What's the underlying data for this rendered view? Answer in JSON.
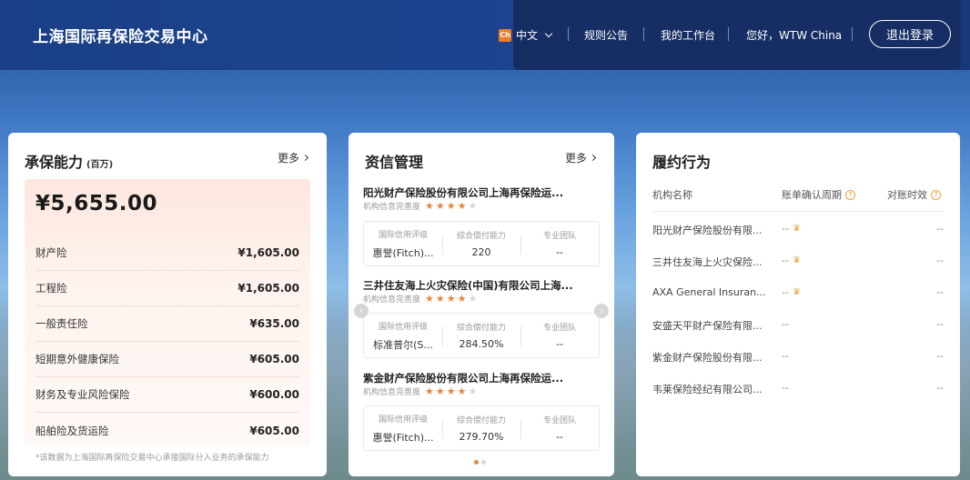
{
  "header": {
    "site_title": "上海国际再保险交易中心",
    "lang_badge": "Ch",
    "lang_label": "中文",
    "nav": [
      "规则公告",
      "我的工作台",
      "您好，WTW China"
    ],
    "logout": "退出登录"
  },
  "capacity": {
    "title": "承保能力",
    "unit": "(百万)",
    "more": "更多",
    "total": "¥5,655.00",
    "rows": [
      {
        "label": "财产险",
        "value": "¥1,605.00"
      },
      {
        "label": "工程险",
        "value": "¥1,605.00"
      },
      {
        "label": "一般责任险",
        "value": "¥635.00"
      },
      {
        "label": "短期意外健康保险",
        "value": "¥605.00"
      },
      {
        "label": "财务及专业风险保险",
        "value": "¥600.00"
      },
      {
        "label": "船舶险及货运险",
        "value": "¥605.00"
      }
    ],
    "note": "*该数据为上海国际再保险交易中心承接国际分入业务的承保能力"
  },
  "credit": {
    "title": "资信管理",
    "more": "更多",
    "info_label": "机构信息完善度",
    "metric_labels": [
      "国际信用评级",
      "综合偿付能力",
      "专业团队"
    ],
    "companies": [
      {
        "name": "阳光财产保险股份有限公司上海再保险运...",
        "stars": 4,
        "rating": "惠誉(Fitch)...",
        "solvency": "220",
        "team": "--"
      },
      {
        "name": "三井住友海上火灾保险(中国)有限公司上海...",
        "stars": 4,
        "rating": "标准普尔(S...",
        "solvency": "284.50%",
        "team": "--"
      },
      {
        "name": "紫金财产保险股份有限公司上海再保险运...",
        "stars": 4,
        "rating": "惠誉(Fitch)...",
        "solvency": "279.70%",
        "team": "--"
      }
    ],
    "page_total": 2,
    "page_active": 1
  },
  "performance": {
    "title": "履约行为",
    "columns": [
      "机构名称",
      "账单确认周期",
      "对账时效"
    ],
    "rows": [
      {
        "name": "阳光财产保险股份有限...",
        "cycle": "--",
        "crown": true,
        "timeliness": "--"
      },
      {
        "name": "三井住友海上火灾保险...",
        "cycle": "--",
        "crown": true,
        "timeliness": "--"
      },
      {
        "name": "AXA General Insuran...",
        "cycle": "--",
        "crown": true,
        "timeliness": "--"
      },
      {
        "name": "安盛天平财产保险有限...",
        "cycle": "--",
        "crown": false,
        "timeliness": "--"
      },
      {
        "name": "紫金财产保险股份有限...",
        "cycle": "--",
        "crown": false,
        "timeliness": "--"
      },
      {
        "name": "韦莱保险经纪有限公司...",
        "cycle": "--",
        "crown": false,
        "timeliness": "--"
      }
    ]
  },
  "colors": {
    "accent": "#e9843b",
    "header": "#1d4590"
  }
}
